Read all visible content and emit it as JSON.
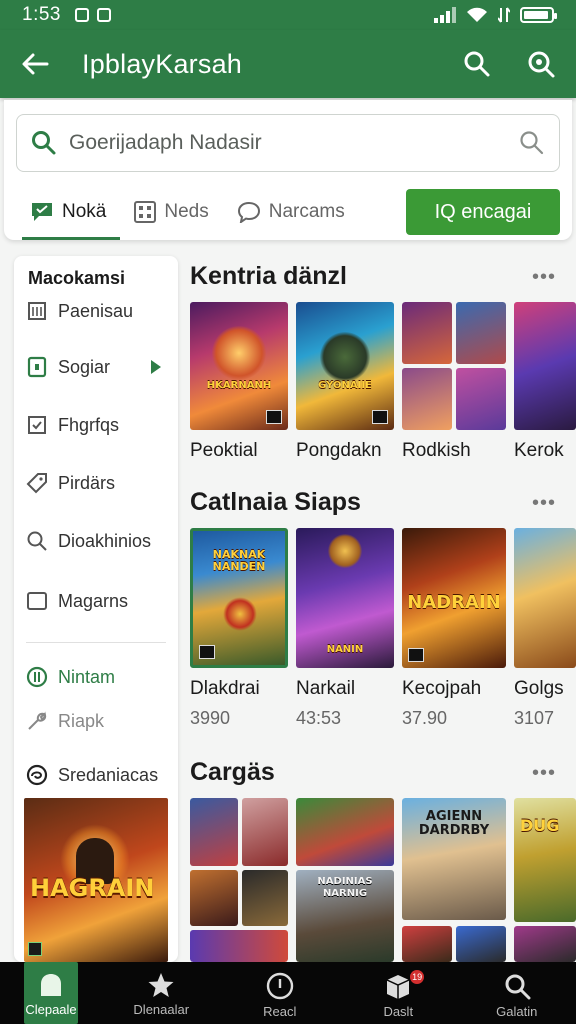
{
  "status_bar": {
    "time": "1:53"
  },
  "app_bar": {
    "title": "IpblayKarsah"
  },
  "search": {
    "placeholder": "Goerijadaph Nadasir"
  },
  "tabs": [
    {
      "label": "Nokä"
    },
    {
      "label": "Neds"
    },
    {
      "label": "Narcams"
    }
  ],
  "cta": {
    "label": "IQ encagai"
  },
  "drawer": {
    "heading": "Macokamsi",
    "items": [
      {
        "label": "Paenisau"
      },
      {
        "label": "Sogiar"
      },
      {
        "label": "Fhgrfqs"
      },
      {
        "label": "Pirdärs"
      },
      {
        "label": "Dioakhinios"
      },
      {
        "label": "Magarns"
      },
      {
        "label": "Nintam"
      },
      {
        "label": "Riapk"
      },
      {
        "label": "Sredaniacas"
      }
    ],
    "promo_text": "HAGRAIN"
  },
  "sections": [
    {
      "title": "Kentria dänzl",
      "games": [
        {
          "name": "Peoktial",
          "art_text": "HKARNANH"
        },
        {
          "name": "Pongdakn",
          "art_text": "GYONAIIE"
        },
        {
          "name": "Rodkish"
        },
        {
          "name": "Kerok"
        }
      ]
    },
    {
      "title": "Catlnaia Siaps",
      "games": [
        {
          "name": "Dlakdrai",
          "price": "3990",
          "art_text": "NAKNAK NANDEN"
        },
        {
          "name": "Narkail",
          "price": "43:53",
          "art_text": "NANIN"
        },
        {
          "name": "Kecojpah",
          "price": "37.90",
          "art_text": "NADRAIN"
        },
        {
          "name": "Golgs",
          "price": "3107"
        }
      ]
    },
    {
      "title": "Cargäs",
      "games": [
        {
          "art_text": "NADINIAS NARNIG"
        },
        {
          "art_text": "AGIENN DARDRBY"
        },
        {
          "art_text": "DUG"
        }
      ]
    }
  ],
  "bottom_nav": [
    {
      "label": "Clepaale"
    },
    {
      "label": "Dlenaalar"
    },
    {
      "label": "Reacl"
    },
    {
      "label": "Daslt",
      "badge": "19"
    },
    {
      "label": "Galatin"
    }
  ],
  "colors": {
    "primary": "#2e7d46",
    "cta": "#3b9a36",
    "nav_bg": "#070707"
  }
}
